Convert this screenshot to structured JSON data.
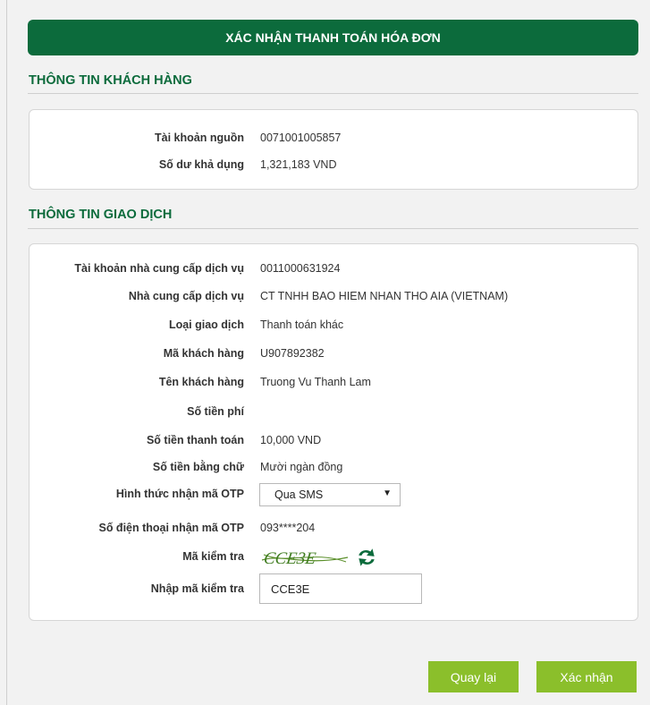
{
  "header": {
    "title": "XÁC NHẬN THANH TOÁN HÓA ĐƠN"
  },
  "customer_section": {
    "title": "THÔNG TIN KHÁCH HÀNG",
    "rows": [
      {
        "label": "Tài khoản nguồn",
        "value": "0071001005857"
      },
      {
        "label": "Số dư khả dụng",
        "value": "1,321,183 VND"
      }
    ]
  },
  "transaction_section": {
    "title": "THÔNG TIN GIAO DỊCH",
    "rows": [
      {
        "label": "Tài khoản nhà cung cấp dịch vụ",
        "value": "0011000631924"
      },
      {
        "label": "Nhà cung cấp dịch vụ",
        "value": "CT TNHH BAO HIEM NHAN THO AIA (VIETNAM)"
      },
      {
        "label": "Loại giao dịch",
        "value": "Thanh toán khác"
      },
      {
        "label": "Mã khách hàng",
        "value": "U907892382"
      },
      {
        "label": "Tên khách hàng",
        "value": "Truong Vu Thanh Lam"
      },
      {
        "label": "Số tiền phí",
        "value": ""
      },
      {
        "label": "Số tiền thanh toán",
        "value": "10,000 VND"
      },
      {
        "label": "Số tiền bằng chữ",
        "value": "Mười ngàn đồng"
      }
    ],
    "otp_method": {
      "label": "Hình thức nhận mã OTP",
      "selected": "Qua SMS"
    },
    "otp_phone": {
      "label": "Số điện thoại nhận mã OTP",
      "value": "093****204"
    },
    "captcha": {
      "label": "Mã kiểm tra",
      "code": "CCE3E",
      "icon": "refresh-icon"
    },
    "captcha_input": {
      "label": "Nhập mã kiểm tra",
      "value": "CCE3E"
    }
  },
  "actions": {
    "back_label": "Quay lại",
    "confirm_label": "Xác nhận"
  },
  "colors": {
    "header_bg": "#0c6b3c",
    "section_title": "#0c6b3c",
    "button_bg": "#8bbf2b"
  }
}
